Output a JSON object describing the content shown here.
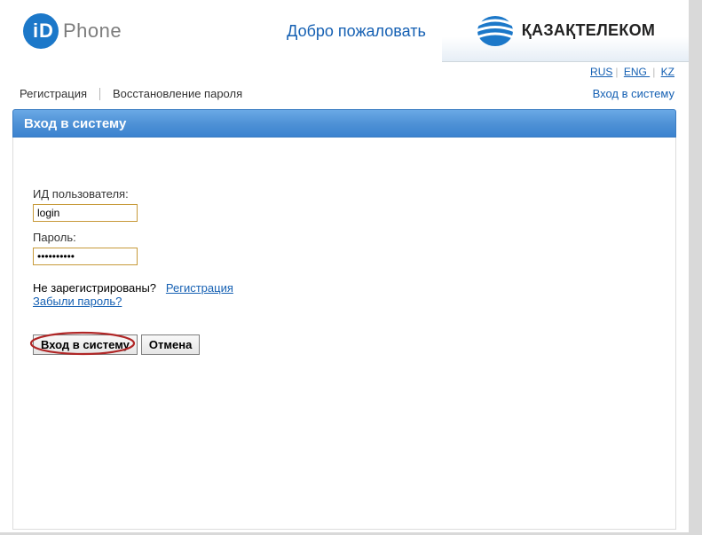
{
  "header": {
    "logo_text": "Phone",
    "welcome": "Добро пожаловать",
    "kt_text": "ҚАЗАҚТЕЛЕКОМ"
  },
  "lang": {
    "ru": "RUS",
    "en": "ENG ",
    "kz": "KZ"
  },
  "nav": {
    "register": "Регистрация",
    "recover": "Восстановление пароля",
    "login": "Вход в систему"
  },
  "titlebar": "Вход в систему",
  "form": {
    "userid_label": "ИД пользователя:",
    "userid_value": "login",
    "password_label": "Пароль:",
    "password_value": "••••••••••",
    "not_registered": "Не зарегистрированы?",
    "register_link": "Регистрация",
    "forgot_link": "Забыли пароль?",
    "submit": "Вход в систему",
    "cancel": "Отмена"
  }
}
